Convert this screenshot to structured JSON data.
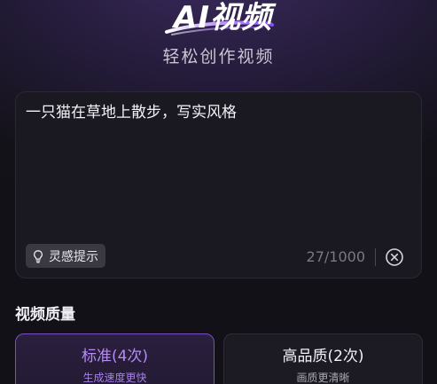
{
  "header": {
    "logo_text": "AI视频",
    "subtitle": "轻松创作视频"
  },
  "prompt": {
    "value": "一只猫在草地上散步，写实风格",
    "hint_label": "灵感提示",
    "counter": "27/1000"
  },
  "quality": {
    "title": "视频质量",
    "options": [
      {
        "label": "标准(4次)",
        "desc": "生成速度更快",
        "selected": true
      },
      {
        "label": "高品质(2次)",
        "desc": "画质更清晰",
        "selected": false
      }
    ]
  },
  "colors": {
    "accent": "#7a4fc0",
    "accent_text": "#b78af5"
  },
  "icons": {
    "hint": "lightbulb-icon",
    "clear": "clear-circle-x-icon"
  }
}
